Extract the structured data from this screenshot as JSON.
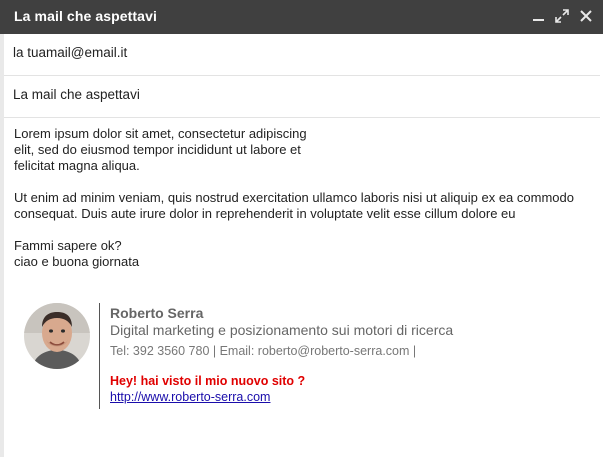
{
  "window": {
    "title": "La mail che aspettavi"
  },
  "compose": {
    "to": "la tuamail@email.it",
    "subject": "La mail che aspettavi"
  },
  "body": {
    "para1_line1": "Lorem ipsum dolor sit amet, consectetur adipiscing",
    "para1_line2": "elit, sed do eiusmod tempor incididunt ut labore et",
    "para1_line3": "felicitat magna aliqua.",
    "para2_line1": "Ut enim ad minim veniam, quis nostrud exercitation ullamco laboris nisi ut aliquip ex ea commodo",
    "para2_line2": "consequat. Duis aute irure dolor in reprehenderit in voluptate velit esse cillum dolore eu",
    "para3_line1": "Fammi sapere ok?",
    "para3_line2": "ciao e buona giornata"
  },
  "signature": {
    "name": "Roberto Serra",
    "role": "Digital marketing e posizionamento sui motori di ricerca",
    "contacts": "Tel: 392 3560 780 | Email: roberto@roberto-serra.com |",
    "promo": "Hey! hai visto il mio nuovo sito ?",
    "link": "http://www.roberto-serra.com"
  },
  "icons": {
    "minimize": "minimize-icon",
    "expand": "expand-icon",
    "close": "close-icon"
  },
  "colors": {
    "titlebar": "#404040",
    "promo": "#e00000",
    "link": "#1a0dab"
  }
}
